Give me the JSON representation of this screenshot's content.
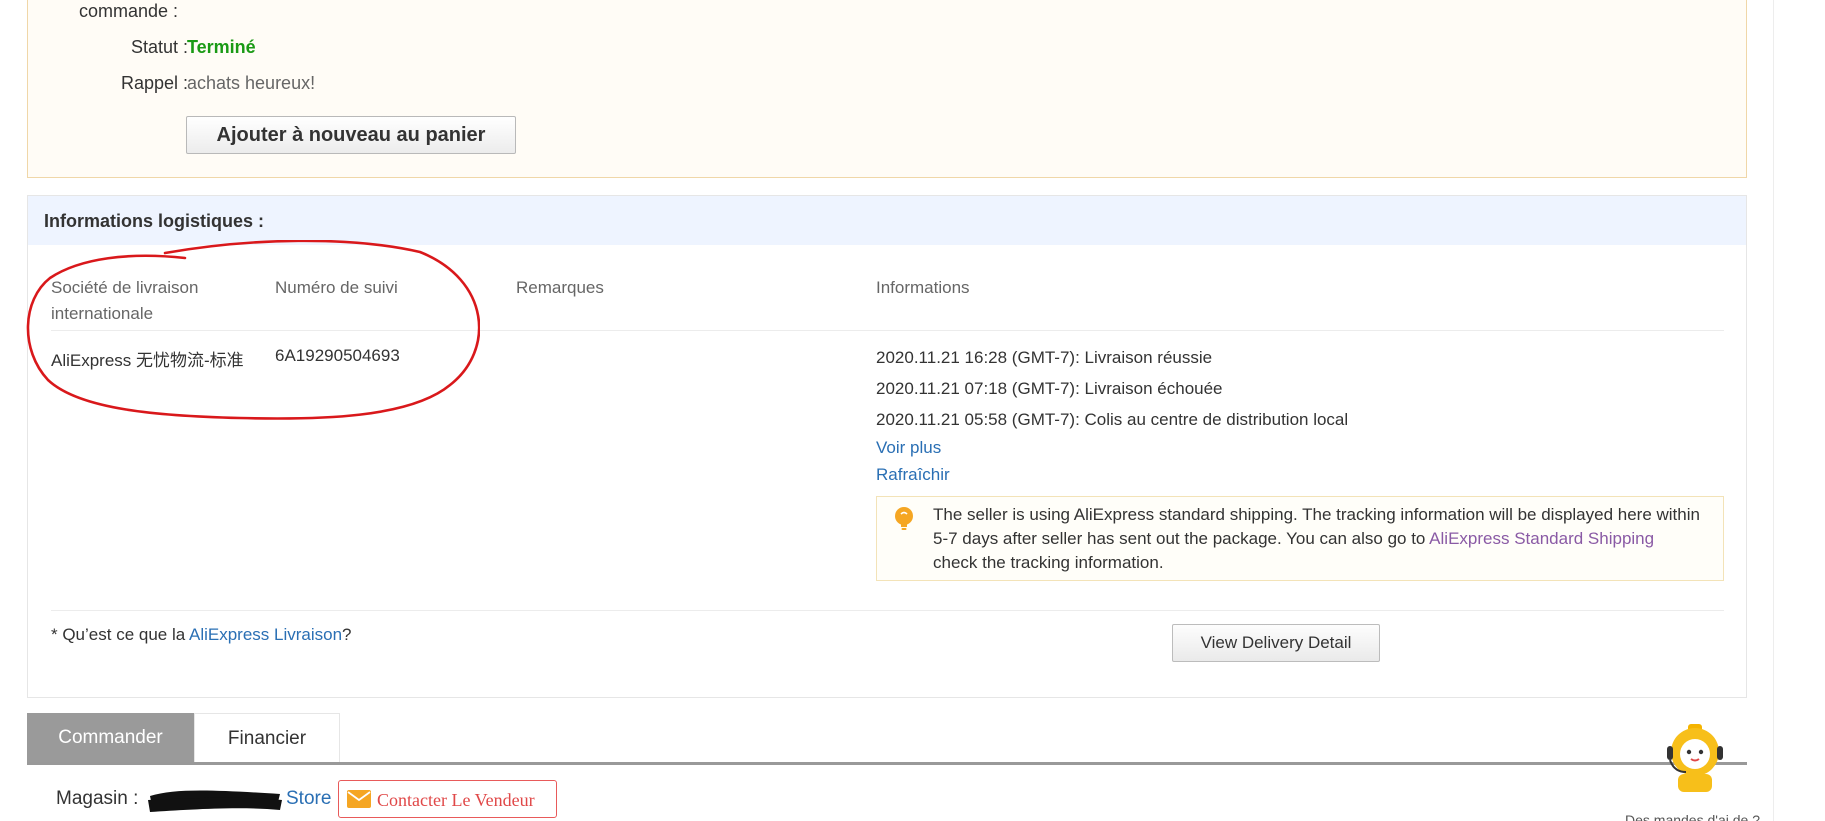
{
  "order": {
    "label_order_cut": "commande :",
    "label_status": "Statut :",
    "status_value": "Terminé",
    "label_reminder": "Rappel :",
    "reminder_value": "achats heureux!",
    "readd_button": "Ajouter à nouveau au panier"
  },
  "logistics": {
    "title": "Informations logistiques :",
    "columns": {
      "company_line1": "Société de livraison",
      "company_line2": "internationale",
      "tracking": "Numéro de suivi",
      "remarks": "Remarques",
      "info": "Informations"
    },
    "row": {
      "company": "AliExpress 无忧物流-标准",
      "tracking_number": "6A19290504693",
      "remarks": ""
    },
    "events": [
      "2020.11.21 16:28 (GMT-7): Livraison réussie",
      "2020.11.21 07:18 (GMT-7): Livraison échouée",
      "2020.11.21 05:58 (GMT-7): Colis au centre de distribution local"
    ],
    "see_more": "Voir plus",
    "refresh": "Rafraîchir",
    "notice": {
      "text_before": "The seller is using AliExpress standard shipping. The tracking information will be displayed here within 5-7 days after seller has sent out the package. You can also go to ",
      "link": "AliExpress Standard Shipping",
      "text_after": " check the tracking information."
    },
    "faq_prefix": "* Qu’est ce que la ",
    "faq_link": "AliExpress Livraison",
    "faq_suffix": "?",
    "view_delivery_button": "View Delivery Detail"
  },
  "tabs": [
    {
      "label": "Commander",
      "active": true
    },
    {
      "label": "Financier",
      "active": false
    }
  ],
  "store": {
    "label": "Magasin :",
    "store_link": "Store",
    "contact_button": "Contacter Le Vendeur"
  },
  "cutoff_text": "Des mandes d'ai de ?",
  "colors": {
    "status_green": "#1a9a15",
    "link_blue": "#2a6fb4",
    "visited_purple": "#8a5aa5",
    "contact_red": "#e04848",
    "annotation_red": "#d9181b",
    "header_bg": "#eef4ff",
    "active_tab_bg": "#9a9a9a"
  },
  "icons": [
    "bulb-icon",
    "envelope-icon",
    "robot-mascot-icon"
  ]
}
